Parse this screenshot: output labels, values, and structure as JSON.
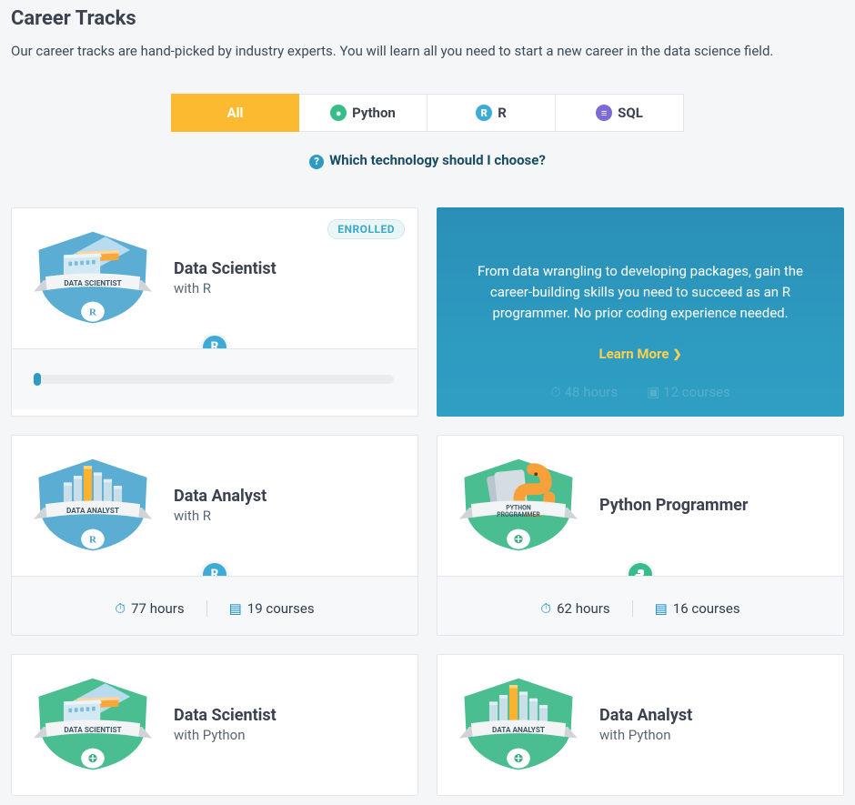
{
  "header": {
    "title": "Career Tracks",
    "subtitle": "Our career tracks are hand-picked by industry experts. You will learn all you need to start a new career in the data science field."
  },
  "tabs": {
    "all": "All",
    "python": "Python",
    "r": "R",
    "sql": "SQL"
  },
  "help_link": "Which technology should I choose?",
  "badges": {
    "enrolled": "ENROLLED"
  },
  "cards": {
    "data_scientist_r": {
      "title": "Data Scientist",
      "subtitle": "with R",
      "badge_label": "DATA SCIENTIST"
    },
    "promo": {
      "text": "From data wrangling to developing packages, gain the career-building skills you need to succeed as an R programmer. No prior coding experience needed.",
      "cta": "Learn More",
      "hours": "48 hours",
      "courses": "12 courses"
    },
    "data_analyst_r": {
      "title": "Data Analyst",
      "subtitle": "with R",
      "badge_label": "DATA ANALYST",
      "hours": "77 hours",
      "courses": "19 courses"
    },
    "python_programmer": {
      "title": "Python Programmer",
      "badge_label": "PYTHON PROGRAMMER",
      "hours": "62 hours",
      "courses": "16 courses"
    },
    "data_scientist_py": {
      "title": "Data Scientist",
      "subtitle": "with Python",
      "badge_label": "DATA SCIENTIST"
    },
    "data_analyst_py": {
      "title": "Data Analyst",
      "subtitle": "with Python",
      "badge_label": "DATA ANALYST"
    }
  }
}
